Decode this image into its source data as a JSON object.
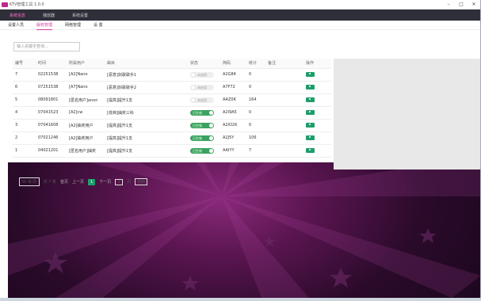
{
  "app": {
    "title": "KTV管理工具 1.0.0",
    "controls": [
      "–",
      "□",
      "✕"
    ]
  },
  "topnav": [
    {
      "label": "系统信息",
      "active": true
    },
    {
      "label": "播放器",
      "active": false
    },
    {
      "label": "系统设置",
      "active": false
    }
  ],
  "subnav": [
    {
      "label": "设置人员",
      "active": false
    },
    {
      "label": "版权管理",
      "active": true
    },
    {
      "label": "网络管理",
      "active": false
    },
    {
      "label": "设 置",
      "active": false
    }
  ],
  "search": {
    "placeholder": "输入关键字查询..."
  },
  "table": {
    "headers": [
      "编号",
      "时间",
      "所属用户",
      "曲目",
      "状态",
      "简码",
      "统计",
      "备注",
      "操作"
    ],
    "rows": [
      {
        "id": "7",
        "time": "02251538",
        "user": "[A2]Nano",
        "song": "[恶意]剑歌歌手1",
        "status": "未启用",
        "code": "A2G84",
        "count": "0",
        "note": ""
      },
      {
        "id": "6",
        "time": "07251538",
        "user": "[A7]Nano",
        "song": "[恶意]剑歌歌手2",
        "status": "未启用",
        "code": "A7F72",
        "count": "0",
        "note": ""
      },
      {
        "id": "5",
        "time": "08091801",
        "user": "[匿名用户]anon",
        "song": "[提高]提升1支",
        "status": "未启用",
        "code": "AAZ0K",
        "count": "164",
        "note": ""
      },
      {
        "id": "4",
        "time": "07041523",
        "user": "[A2]cw",
        "song": "[低档]抽奖三科",
        "status": "已生效",
        "code": "A2I9A5",
        "count": "0",
        "note": ""
      },
      {
        "id": "3",
        "time": "07041608",
        "user": "[A2]抽奖用户",
        "song": "[提高]提升1支",
        "status": "已生效",
        "code": "A2IO2K",
        "count": "0",
        "note": ""
      },
      {
        "id": "2",
        "time": "07021246",
        "user": "[A2]抽奖用户",
        "song": "[提高]提升1支",
        "status": "已生效",
        "code": "A2J5Y",
        "count": "106",
        "note": ""
      },
      {
        "id": "1",
        "time": "04021201",
        "user": "[匿名用户]抽奖",
        "song": "[提高]提升1支",
        "status": "已生效",
        "code": "AAIYY",
        "count": "7",
        "note": ""
      }
    ]
  },
  "pager": {
    "size": "50 条/页",
    "total": "共 7 条",
    "first": "首页",
    "prev": "上一页",
    "current": "1",
    "next": "下一页",
    "goto_value": "1",
    "page_unit": "页",
    "go": "跳转"
  },
  "colors": {
    "accent": "#d63aa4",
    "active_green": "#1f9d6b",
    "nav_bg": "#2f2f3a"
  }
}
